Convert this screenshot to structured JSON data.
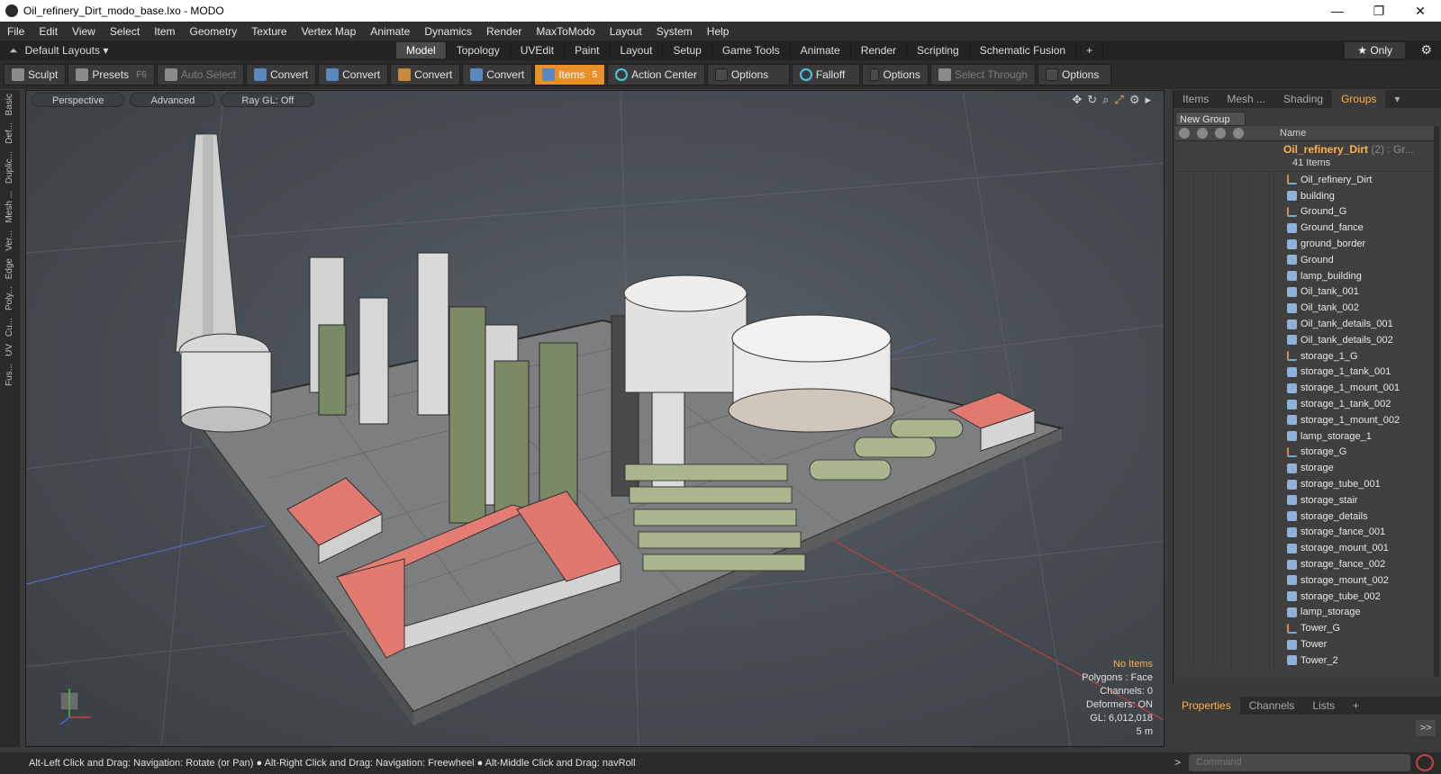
{
  "window": {
    "title": "Oil_refinery_Dirt_modo_base.lxo - MODO",
    "controls": [
      "—",
      "❐",
      "✕"
    ]
  },
  "menu": [
    "File",
    "Edit",
    "View",
    "Select",
    "Item",
    "Geometry",
    "Texture",
    "Vertex Map",
    "Animate",
    "Dynamics",
    "Render",
    "MaxToModo",
    "Layout",
    "System",
    "Help"
  ],
  "layout_bar": {
    "layouts_label": "Default Layouts ▾",
    "tabs": [
      "Model",
      "Topology",
      "UVEdit",
      "Paint",
      "Layout",
      "Setup",
      "Game Tools",
      "Animate",
      "Render",
      "Scripting",
      "Schematic Fusion",
      "+"
    ],
    "active_tab": "Model",
    "only_label": "★  Only"
  },
  "toolbar": {
    "sculpt": "Sculpt",
    "presets": "Presets",
    "presets_key": "F6",
    "auto_select": "Auto Select",
    "convert": "Convert",
    "items": "Items",
    "items_key": "5",
    "action_center": "Action Center",
    "options": "Options",
    "falloff": "Falloff",
    "select_through": "Select Through"
  },
  "left_tabs": [
    "Basic",
    "Def...",
    "Duplic...",
    "Mesh ...",
    "Ver...",
    "Edge",
    "Poly...",
    "Cu...",
    "UV",
    "Fus..."
  ],
  "viewport": {
    "view": "Perspective",
    "shading": "Advanced",
    "raygl": "Ray GL: Off",
    "info": {
      "no_items": "No Items",
      "polygons": "Polygons : Face",
      "channels": "Channels: 0",
      "deformers": "Deformers: ON",
      "gl": "GL: 6,012,018",
      "scale": "5 m"
    }
  },
  "right_panel": {
    "tabs": [
      "Items",
      "Mesh ...",
      "Shading",
      "Groups"
    ],
    "active_tab": "Groups",
    "new_group": "New Group",
    "name_col": "Name",
    "group_name": "Oil_refinery_Dirt",
    "group_suffix": "(2) : Gr...",
    "group_count": "41 Items",
    "items": [
      {
        "name": "Oil_refinery_Dirt",
        "type": "locator"
      },
      {
        "name": "building",
        "type": "mesh"
      },
      {
        "name": "Ground_G",
        "type": "locator"
      },
      {
        "name": "Ground_fance",
        "type": "mesh"
      },
      {
        "name": "ground_border",
        "type": "mesh"
      },
      {
        "name": "Ground",
        "type": "mesh"
      },
      {
        "name": "lamp_building",
        "type": "mesh"
      },
      {
        "name": "Oil_tank_001",
        "type": "mesh"
      },
      {
        "name": "Oil_tank_002",
        "type": "mesh"
      },
      {
        "name": "Oil_tank_details_001",
        "type": "mesh"
      },
      {
        "name": "Oil_tank_details_002",
        "type": "mesh"
      },
      {
        "name": "storage_1_G",
        "type": "locator"
      },
      {
        "name": "storage_1_tank_001",
        "type": "mesh"
      },
      {
        "name": "storage_1_mount_001",
        "type": "mesh"
      },
      {
        "name": "storage_1_tank_002",
        "type": "mesh"
      },
      {
        "name": "storage_1_mount_002",
        "type": "mesh"
      },
      {
        "name": "lamp_storage_1",
        "type": "mesh"
      },
      {
        "name": "storage_G",
        "type": "locator"
      },
      {
        "name": "storage",
        "type": "mesh"
      },
      {
        "name": "storage_tube_001",
        "type": "mesh"
      },
      {
        "name": "storage_stair",
        "type": "mesh"
      },
      {
        "name": "storage_details",
        "type": "mesh"
      },
      {
        "name": "storage_fance_001",
        "type": "mesh"
      },
      {
        "name": "storage_mount_001",
        "type": "mesh"
      },
      {
        "name": "storage_fance_002",
        "type": "mesh"
      },
      {
        "name": "storage_mount_002",
        "type": "mesh"
      },
      {
        "name": "storage_tube_002",
        "type": "mesh"
      },
      {
        "name": "lamp_storage",
        "type": "mesh"
      },
      {
        "name": "Tower_G",
        "type": "locator"
      },
      {
        "name": "Tower",
        "type": "mesh"
      },
      {
        "name": "Tower_2",
        "type": "mesh"
      }
    ]
  },
  "props_bar": {
    "tabs": [
      "Properties",
      "Channels",
      "Lists",
      "+"
    ],
    "active_tab": "Properties",
    "go": ">>"
  },
  "command": {
    "placeholder": "Command",
    "arrow": ">"
  },
  "status": {
    "message": "Alt-Left Click and Drag: Navigation: Rotate (or Pan) ● Alt-Right Click and Drag: Navigation: Freewheel ● Alt-Middle Click and Drag: navRoll"
  },
  "colors": {
    "accent": "#e8902a",
    "orange_text": "#ffb04a",
    "roof": "#e0716a"
  }
}
